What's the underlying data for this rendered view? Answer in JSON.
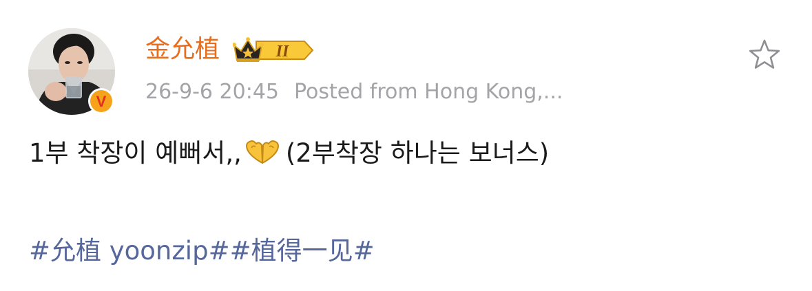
{
  "post": {
    "author": {
      "name": "金允植",
      "vip_level": "II",
      "verified_mark": "V"
    },
    "timestamp": "26-9-6 20:45",
    "source": "Posted from Hong Kong,...",
    "content_before_emoji": "1부 착장이 예뻐서,,",
    "emoji": "heart-hands-emoji",
    "content_after_emoji": "(2부착장 하나는 보너스)",
    "hashtags": [
      "#允植 yoonzip#",
      "#植得一见#"
    ]
  },
  "colors": {
    "username": "#e86d1c",
    "hashtag": "#56679c",
    "meta": "#a4a4a8",
    "text": "#1a1a1a",
    "verified_badge": "#f7a21b"
  }
}
